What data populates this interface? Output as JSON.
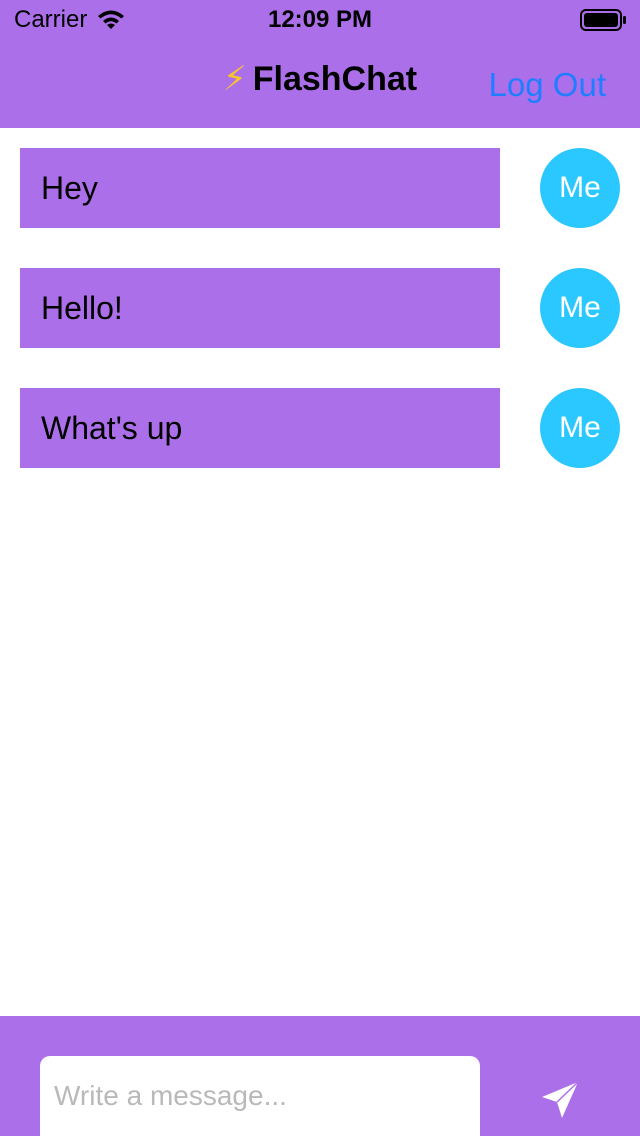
{
  "status_bar": {
    "carrier": "Carrier",
    "time": "12:09 PM"
  },
  "nav": {
    "title_icon": "lightning-bolt-icon",
    "title_icon_glyph": "⚡",
    "title": "FlashChat",
    "logout_label": "Log Out"
  },
  "messages": [
    {
      "text": "Hey",
      "avatar_label": "Me"
    },
    {
      "text": "Hello!",
      "avatar_label": "Me"
    },
    {
      "text": "What's up",
      "avatar_label": "Me"
    }
  ],
  "composer": {
    "placeholder": "Write a message...",
    "value": "",
    "send_icon": "paper-plane-icon"
  },
  "colors": {
    "brand_purple": "#AC6FEA",
    "avatar_blue": "#2BC8FF",
    "link_blue": "#1E7EFF"
  }
}
